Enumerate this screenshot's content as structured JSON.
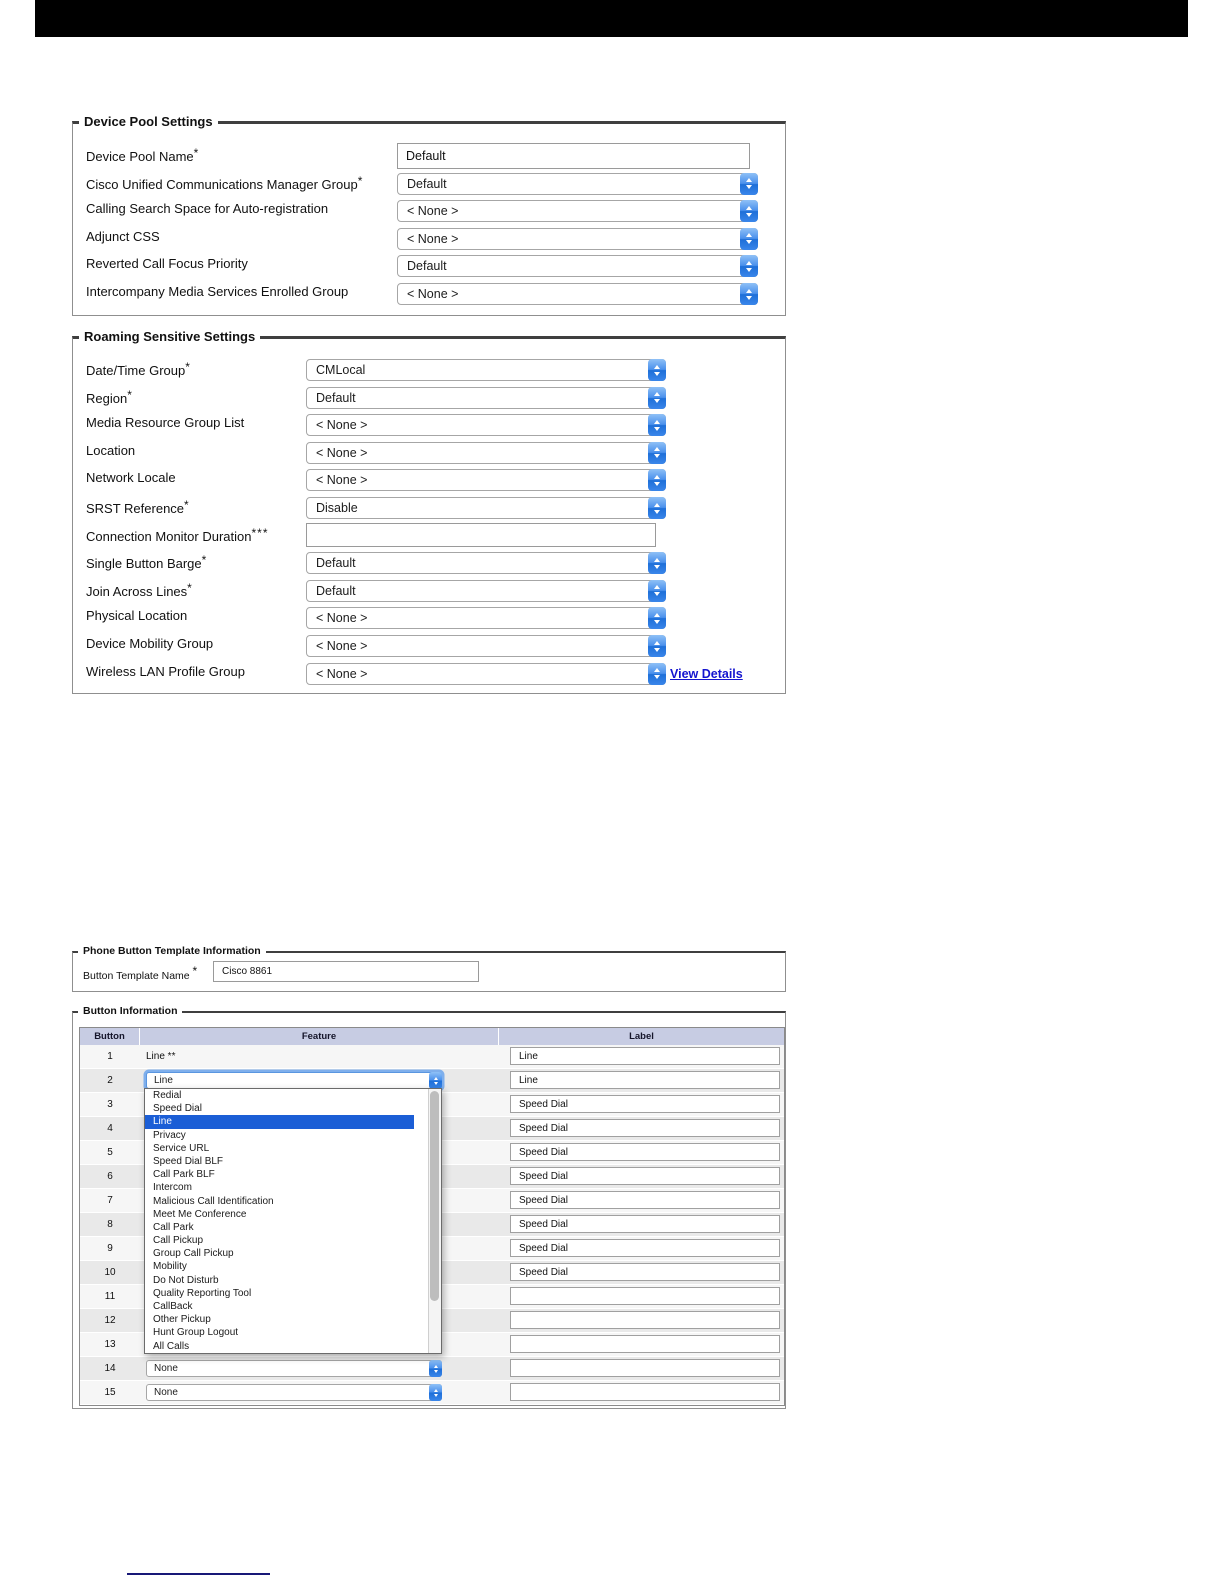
{
  "top_bar": {
    "color": "#000000"
  },
  "device_pool": {
    "legend": "Device Pool Settings",
    "rows": [
      {
        "label": "Device Pool Name",
        "mark": "*",
        "control": "input",
        "value": "Default"
      },
      {
        "label": "Cisco Unified Communications Manager Group",
        "mark": "*",
        "control": "select",
        "value": "Default"
      },
      {
        "label": "Calling Search Space for Auto-registration",
        "mark": "",
        "control": "select",
        "value": "< None >"
      },
      {
        "label": "Adjunct CSS",
        "mark": "",
        "control": "select",
        "value": "< None >"
      },
      {
        "label": "Reverted Call Focus Priority",
        "mark": "",
        "control": "select",
        "value": "Default"
      },
      {
        "label": "Intercompany Media Services Enrolled Group",
        "mark": "",
        "control": "select",
        "value": "< None >"
      }
    ]
  },
  "roaming": {
    "legend": "Roaming Sensitive Settings",
    "rows": [
      {
        "label": "Date/Time Group",
        "mark": "*",
        "control": "select",
        "value": "CMLocal"
      },
      {
        "label": "Region",
        "mark": "*",
        "control": "select",
        "value": "Default"
      },
      {
        "label": "Media Resource Group List",
        "mark": "",
        "control": "select",
        "value": "< None >"
      },
      {
        "label": "Location",
        "mark": "",
        "control": "select",
        "value": "< None >"
      },
      {
        "label": "Network Locale",
        "mark": "",
        "control": "select",
        "value": "< None >"
      },
      {
        "label": "SRST Reference",
        "mark": "*",
        "control": "select",
        "value": "Disable"
      },
      {
        "label": "Connection Monitor Duration",
        "mark": "***",
        "control": "input",
        "value": ""
      },
      {
        "label": "Single Button Barge",
        "mark": "*",
        "control": "select",
        "value": "Default"
      },
      {
        "label": "Join Across Lines",
        "mark": "*",
        "control": "select",
        "value": "Default"
      },
      {
        "label": "Physical Location",
        "mark": "",
        "control": "select",
        "value": "< None >"
      },
      {
        "label": "Device Mobility Group",
        "mark": "",
        "control": "select",
        "value": "< None >"
      },
      {
        "label": "Wireless LAN Profile Group",
        "mark": "",
        "control": "select",
        "value": "< None >",
        "link": "View Details"
      }
    ]
  },
  "phone_template": {
    "legend": "Phone Button Template Information",
    "field_label": "Button Template Name",
    "field_mark": "*",
    "value": "Cisco 8861"
  },
  "button_info": {
    "legend": "Button Information",
    "headers": [
      "Button",
      "Feature",
      "Label"
    ],
    "rows": [
      {
        "num": "1",
        "type": "text",
        "feature": "Line **",
        "label": "Line"
      },
      {
        "num": "2",
        "type": "select-focused",
        "feature": "Line",
        "label": "Line"
      },
      {
        "num": "3",
        "type": "covered",
        "feature": "",
        "label": "Speed Dial"
      },
      {
        "num": "4",
        "type": "covered",
        "feature": "",
        "label": "Speed Dial"
      },
      {
        "num": "5",
        "type": "covered",
        "feature": "",
        "label": "Speed Dial"
      },
      {
        "num": "6",
        "type": "covered",
        "feature": "",
        "label": "Speed Dial"
      },
      {
        "num": "7",
        "type": "covered",
        "feature": "",
        "label": "Speed Dial"
      },
      {
        "num": "8",
        "type": "covered",
        "feature": "",
        "label": "Speed Dial"
      },
      {
        "num": "9",
        "type": "covered",
        "feature": "",
        "label": "Speed Dial"
      },
      {
        "num": "10",
        "type": "covered",
        "feature": "",
        "label": "Speed Dial"
      },
      {
        "num": "11",
        "type": "covered",
        "feature": "",
        "label": ""
      },
      {
        "num": "12",
        "type": "covered",
        "feature": "",
        "label": ""
      },
      {
        "num": "13",
        "type": "covered",
        "feature": "",
        "label": ""
      },
      {
        "num": "14",
        "type": "select",
        "feature": "None",
        "label": ""
      },
      {
        "num": "15",
        "type": "select",
        "feature": "None",
        "label": ""
      }
    ],
    "dropdown": {
      "selected": "Line",
      "items": [
        "Redial",
        "Speed Dial",
        "Line",
        "Privacy",
        "Service URL",
        "Speed Dial BLF",
        "Call Park BLF",
        "Intercom",
        "Malicious Call Identification",
        "Meet Me Conference",
        "Call Park",
        "Call Pickup",
        "Group Call Pickup",
        "Mobility",
        "Do Not Disturb",
        "Quality Reporting Tool",
        "CallBack",
        "Other Pickup",
        "Hunt Group Logout",
        "All Calls"
      ]
    }
  },
  "colors": {
    "stepper_blue": "#2e7be4",
    "table_header_bg": "#c7cce3",
    "dropdown_highlight": "#1b5ed6",
    "link_blue": "#1414cf"
  }
}
